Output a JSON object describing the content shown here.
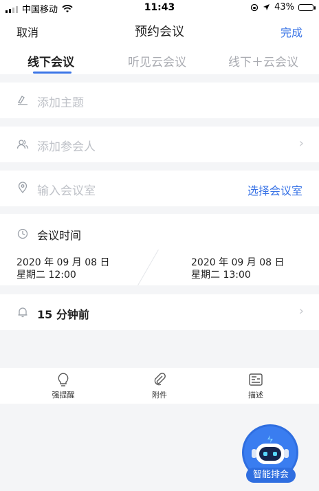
{
  "statusbar": {
    "carrier": "中国移动",
    "time": "11:43",
    "battery": "43%",
    "battery_level": 0.43
  },
  "navbar": {
    "cancel": "取消",
    "title": "预约会议",
    "done": "完成"
  },
  "tabs": [
    {
      "label": "线下会议",
      "active": true
    },
    {
      "label": "听见云会议",
      "active": false
    },
    {
      "label": "线下＋云会议",
      "active": false
    }
  ],
  "form": {
    "topic_placeholder": "添加主题",
    "attendees_placeholder": "添加参会人",
    "room_placeholder": "输入会议室",
    "room_link": "选择会议室",
    "time_title": "会议时间",
    "start": {
      "date": "2020 年 09 月 08 日",
      "time": "星期二 12:00"
    },
    "end": {
      "date": "2020 年 09 月 08 日",
      "time": "星期二 13:00"
    },
    "reminder": "15 分钟前"
  },
  "toolbar": {
    "items": [
      {
        "label": "强提醒",
        "icon": "lightbulb-icon"
      },
      {
        "label": "附件",
        "icon": "paperclip-icon"
      },
      {
        "label": "描述",
        "icon": "document-icon"
      }
    ]
  },
  "assistant": {
    "label": "智能排会"
  },
  "colors": {
    "accent": "#3a74e6",
    "placeholder": "#bfc2c8",
    "background": "#f4f5f7"
  }
}
